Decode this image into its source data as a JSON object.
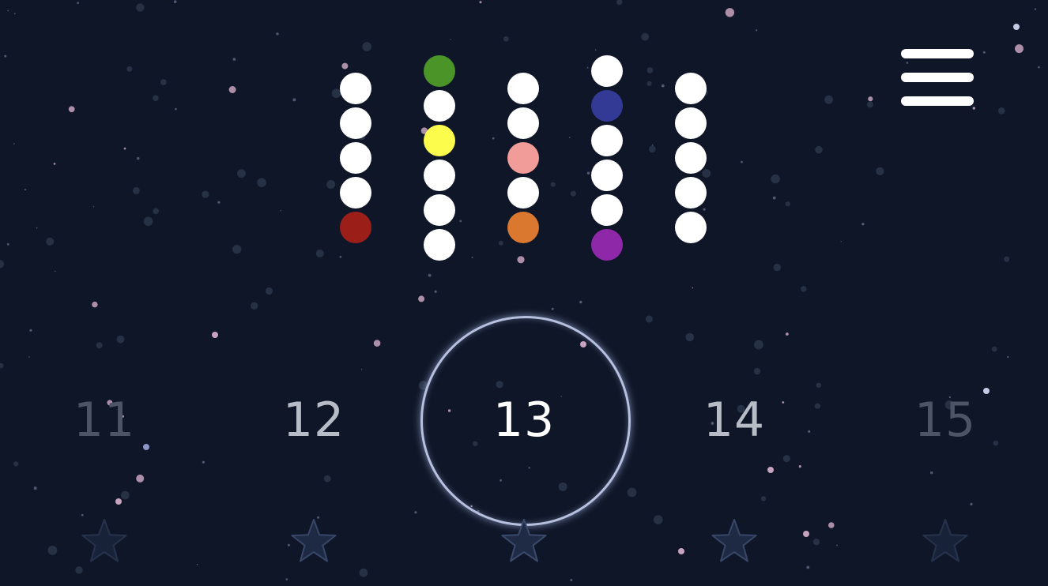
{
  "menu": {
    "icon": "hamburger-menu-icon"
  },
  "puzzle": {
    "columns": [
      {
        "balls": [
          "white",
          "white",
          "white",
          "white",
          "red"
        ]
      },
      {
        "balls": [
          "green",
          "white",
          "yellow",
          "white",
          "white",
          "white"
        ]
      },
      {
        "balls": [
          "white",
          "white",
          "pink",
          "white",
          "orange"
        ]
      },
      {
        "balls": [
          "white",
          "navy",
          "white",
          "white",
          "white",
          "purple"
        ]
      },
      {
        "balls": [
          "white",
          "white",
          "white",
          "white",
          "white"
        ]
      }
    ]
  },
  "colors": {
    "background": "#0f1628",
    "white": "#ffffff",
    "red": "#9b1e18",
    "green": "#4a9428",
    "yellow": "#fcfc4c",
    "pink": "#f29c9a",
    "orange": "#d9782e",
    "navy": "#333a96",
    "purple": "#8e28a9",
    "level_selected": "#ffffff",
    "level_near": "#b7bcc6",
    "level_far": "#4c5466",
    "star_empty": "#1f2b45",
    "star_outline": "#3a4a6b"
  },
  "levels": [
    {
      "number": "11",
      "stars_earned": 0,
      "selected": false
    },
    {
      "number": "12",
      "stars_earned": 0,
      "selected": false
    },
    {
      "number": "13",
      "stars_earned": 0,
      "selected": true
    },
    {
      "number": "14",
      "stars_earned": 0,
      "selected": false
    },
    {
      "number": "15",
      "stars_earned": 0,
      "selected": false
    }
  ],
  "icons": {
    "level_star": "star-icon"
  }
}
